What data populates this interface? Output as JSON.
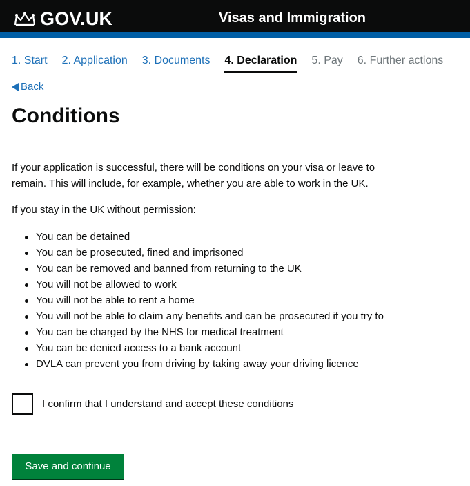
{
  "header": {
    "logo_text": "GOV.UK",
    "service_name": "Visas and Immigration"
  },
  "steps": [
    {
      "label": "1. Start",
      "state": "done"
    },
    {
      "label": "2. Application",
      "state": "done"
    },
    {
      "label": "3. Documents",
      "state": "done"
    },
    {
      "label": "4. Declaration",
      "state": "current"
    },
    {
      "label": "5. Pay",
      "state": "future"
    },
    {
      "label": "6. Further actions",
      "state": "future"
    }
  ],
  "back_link": "Back",
  "page_title": "Conditions",
  "intro_line1": "If your application is successful, there will be conditions on your visa or leave to",
  "intro_line2": "remain. This will include, for example, whether you are able to work in the UK.",
  "warning_intro": "If you stay in the UK without permission:",
  "consequences": [
    "You can be detained",
    "You can be prosecuted, fined and imprisoned",
    "You can be removed and banned from returning to the UK",
    "You will not be allowed to work",
    "You will not be able to rent a home",
    "You will not be able to claim any benefits and can be prosecuted if you try to",
    "You can be charged by the NHS for medical treatment",
    "You can be denied access to a bank account",
    "DVLA can prevent you from driving by taking away your driving licence"
  ],
  "confirm_label": "I confirm that I understand and accept these conditions",
  "save_button": "Save and continue",
  "colors": {
    "header_bg": "#0b0c0c",
    "header_stripe": "#005ea5",
    "link": "#1d70b8",
    "button": "#00823b"
  }
}
